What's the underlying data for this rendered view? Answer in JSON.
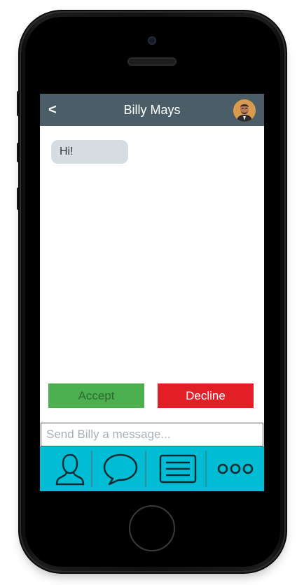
{
  "header": {
    "back_label": "<",
    "contact_name": "Billy Mays"
  },
  "messages": [
    {
      "text": "Hi!"
    }
  ],
  "actions": {
    "accept_label": "Accept",
    "decline_label": "Decline"
  },
  "composer": {
    "placeholder": "Send Billy a message...",
    "value": ""
  },
  "tabbar": {
    "tabs": [
      {
        "icon": "profile-icon"
      },
      {
        "icon": "chat-bubble-icon"
      },
      {
        "icon": "list-icon"
      },
      {
        "icon": "more-icon"
      }
    ]
  },
  "colors": {
    "header_bg": "#4b5d66",
    "bubble_bg": "#d5dde3",
    "accept": "#4caf50",
    "decline": "#e21f26",
    "tabbar_bg": "#00bcd4"
  }
}
